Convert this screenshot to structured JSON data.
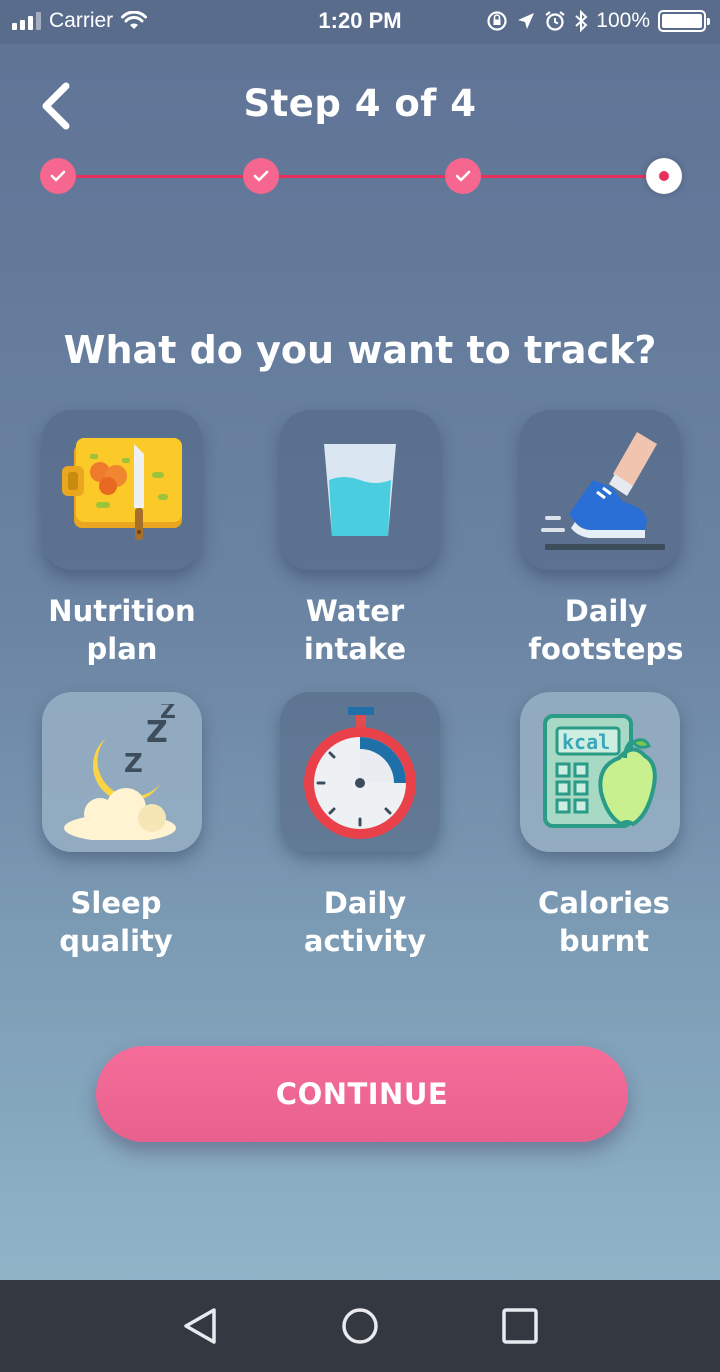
{
  "status_bar": {
    "carrier": "Carrier",
    "time": "1:20 PM",
    "battery_percent": "100%",
    "icons": [
      "signal-icon",
      "wifi-icon",
      "orientation-lock-icon",
      "location-icon",
      "alarm-icon",
      "bluetooth-icon",
      "battery-icon"
    ]
  },
  "header": {
    "title": "Step 4 of 4",
    "back_icon": "chevron-left-icon"
  },
  "progress": {
    "total_steps": 4,
    "current_step": 4,
    "completed_icon": "check-icon",
    "accent_color": "#e8305e",
    "completed_color": "#f5678f"
  },
  "question": "What do you want to track?",
  "options": [
    {
      "label": "Nutrition\nplan",
      "icon": "cutting-board-icon"
    },
    {
      "label": "Water\nintake",
      "icon": "water-glass-icon"
    },
    {
      "label": "Daily\nfootsteps",
      "icon": "running-shoe-icon"
    },
    {
      "label": "Sleep\nquality",
      "icon": "moon-sleep-icon"
    },
    {
      "label": "Daily\nactivity",
      "icon": "stopwatch-icon"
    },
    {
      "label": "Calories\nburnt",
      "icon": "calculator-apple-icon",
      "kcal_text": "kcal"
    }
  ],
  "continue_label": "CONTINUE",
  "nav_bar": {
    "icons": [
      "back-triangle-icon",
      "home-circle-icon",
      "recents-square-icon"
    ]
  }
}
